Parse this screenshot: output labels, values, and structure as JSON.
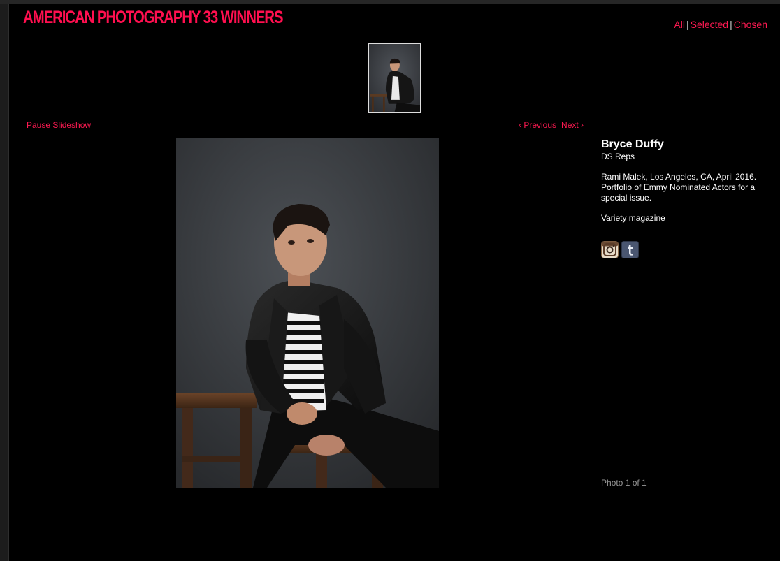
{
  "header": {
    "site_title": "AMERICAN PHOTOGRAPHY 33 WINNERS",
    "filters": [
      {
        "label": "All"
      },
      {
        "label": "Selected"
      },
      {
        "label": "Chosen"
      }
    ],
    "separator": "|"
  },
  "slideshow": {
    "pause_label": "Pause Slideshow",
    "previous_label": "‹ Previous",
    "next_label": "Next ›"
  },
  "info": {
    "photographer": "Bryce Duffy",
    "agency": "DS Reps",
    "caption_line1": "Rami Malek, Los Angeles, CA, April 2016.",
    "caption_line2": "Portfolio of Emmy Nominated Actors for a special issue.",
    "publication": "Variety magazine",
    "photo_count": "Photo 1 of 1"
  },
  "social": {
    "icons": [
      "instagram-icon",
      "tumblr-icon"
    ]
  },
  "colors": {
    "accent": "#ff1a52",
    "background": "#000000",
    "text": "#ffffff",
    "muted": "#999999"
  }
}
